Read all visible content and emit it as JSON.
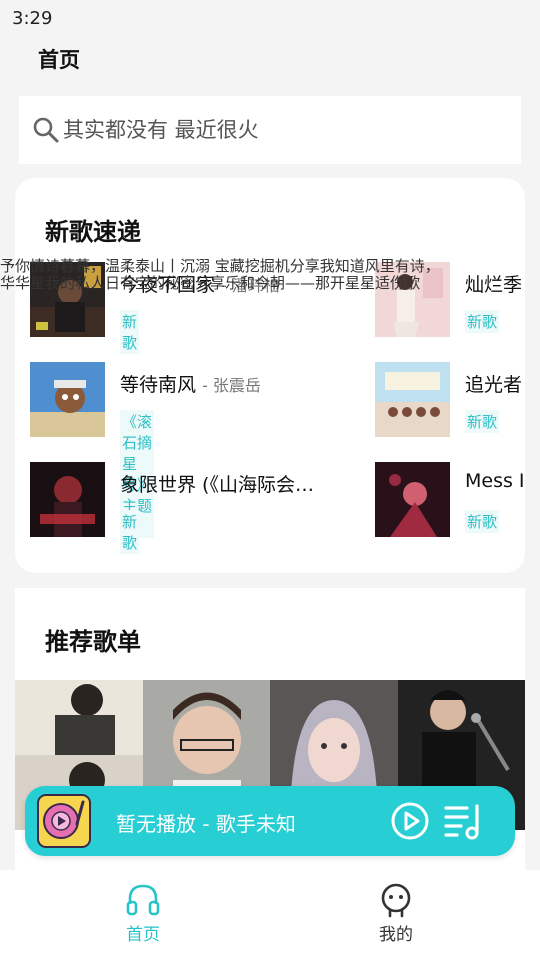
{
  "status": {
    "time": "3:29"
  },
  "header": {
    "title": "首页"
  },
  "search": {
    "placeholder": "其实都没有 最近很火"
  },
  "new_songs": {
    "title": "新歌速递",
    "items": [
      {
        "title": "今夜不回家",
        "artist": "- 潘玮柏",
        "tag": "新歌"
      },
      {
        "title": "灿烂季",
        "artist": "",
        "tag": "新歌"
      },
      {
        "title": "等待南风",
        "artist": "- 张震岳",
        "tag": "《滚石摘星号》主题曲"
      },
      {
        "title": "追光者",
        "artist": "",
        "tag": "新歌"
      },
      {
        "title": "象限世界 (《山海际会…",
        "artist": "",
        "tag": "新歌"
      },
      {
        "title": "Mess I",
        "artist": "",
        "tag": "新歌"
      }
    ]
  },
  "playlists": {
    "title": "推荐歌单",
    "description_line1": "予你情诗暮暮，温柔泰山丨沉溺 宝藏挖掘机分享我知道风里有诗，",
    "description_line2": "华华星我的私人日有宝的秘密分享乐和今朝——那开星星适伤歌"
  },
  "player": {
    "text": "暂无播放 - 歌手未知"
  },
  "nav": {
    "home": "首页",
    "mine": "我的"
  },
  "colors": {
    "accent": "#27ced3",
    "tag_text": "#2ec0c6"
  }
}
